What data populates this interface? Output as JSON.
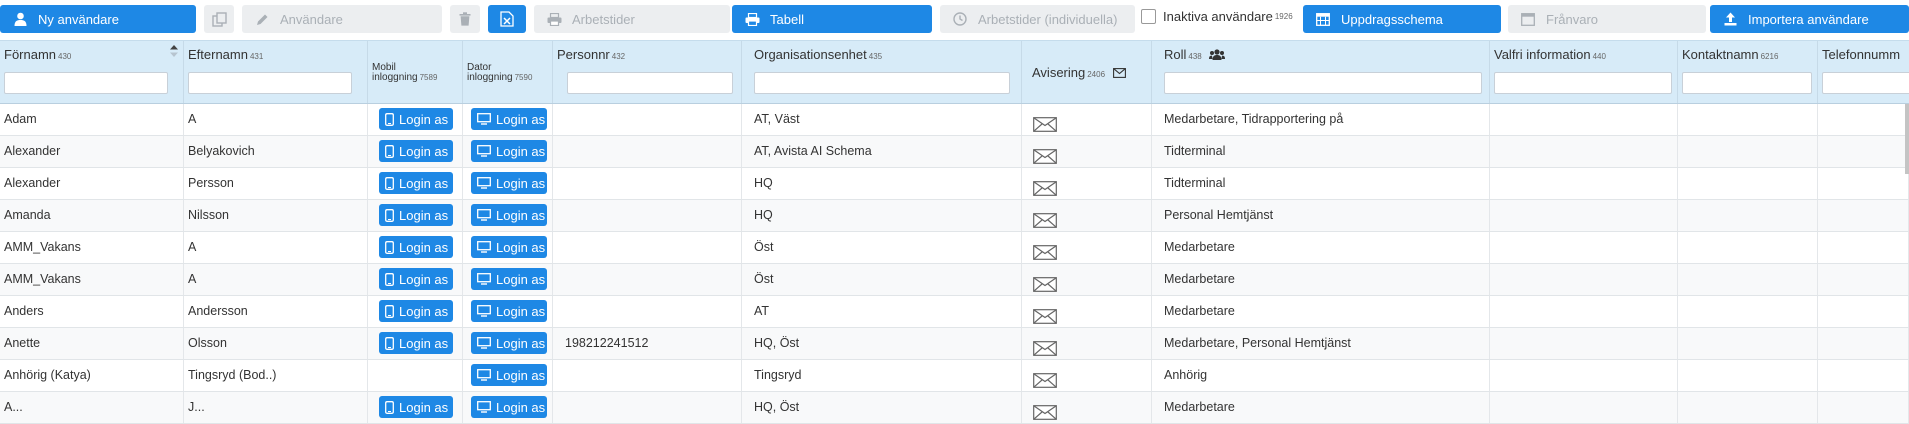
{
  "toolbar": {
    "new_user": "Ny användare",
    "users": "Användare",
    "worktimes": "Arbetstider",
    "table": "Tabell",
    "worktimes_individual": "Arbetstider (individuella)",
    "inactive_label": "Inaktiva användare",
    "inactive_count": "1926",
    "assignment_schedule": "Uppdragsschema",
    "absence": "Frånvaro",
    "import_users": "Importera användare"
  },
  "columns": {
    "firstname": {
      "label": "Förnamn",
      "num": "430"
    },
    "lastname": {
      "label": "Efternamn",
      "num": "431"
    },
    "mobile": {
      "label": "Mobil inloggning",
      "num": "7589"
    },
    "desktop": {
      "label": "Dator inloggning",
      "num": "7590"
    },
    "personnr": {
      "label": "Personnr",
      "num": "432"
    },
    "org": {
      "label": "Organisationsenhet",
      "num": "435"
    },
    "notify": {
      "label": "Avisering",
      "num": "2406"
    },
    "role": {
      "label": "Roll",
      "num": "438"
    },
    "optional": {
      "label": "Valfri information",
      "num": "440"
    },
    "contact": {
      "label": "Kontaktnamn",
      "num": "6216"
    },
    "phone": {
      "label": "Telefonnumm"
    }
  },
  "login_label": "Login as",
  "rows": [
    {
      "first": "Adam",
      "last": "A",
      "mobile": true,
      "desktop": true,
      "pnr": "",
      "org": "AT, Väst",
      "role": "Medarbetare, Tidrapportering på"
    },
    {
      "first": "Alexander",
      "last": "Belyakovich",
      "mobile": true,
      "desktop": true,
      "pnr": "",
      "org": "AT, Avista AI Schema",
      "role": "Tidterminal"
    },
    {
      "first": "Alexander",
      "last": "Persson",
      "mobile": true,
      "desktop": true,
      "pnr": "",
      "org": "HQ",
      "role": "Tidterminal"
    },
    {
      "first": "Amanda",
      "last": "Nilsson",
      "mobile": true,
      "desktop": true,
      "pnr": "",
      "org": "HQ",
      "role": "Personal Hemtjänst"
    },
    {
      "first": "AMM_Vakans",
      "last": "A",
      "mobile": true,
      "desktop": true,
      "pnr": "",
      "org": "Öst",
      "role": "Medarbetare"
    },
    {
      "first": "AMM_Vakans",
      "last": "A",
      "mobile": true,
      "desktop": true,
      "pnr": "",
      "org": "Öst",
      "role": "Medarbetare"
    },
    {
      "first": "Anders",
      "last": "Andersson",
      "mobile": true,
      "desktop": true,
      "pnr": "",
      "org": "AT",
      "role": "Medarbetare"
    },
    {
      "first": "Anette",
      "last": "Olsson",
      "mobile": true,
      "desktop": true,
      "pnr": "198212241512",
      "org": "HQ, Öst",
      "role": "Medarbetare, Personal Hemtjänst"
    },
    {
      "first": "Anhörig (Katya)",
      "last": "Tingsryd (Bod..)",
      "mobile": false,
      "desktop": true,
      "pnr": "",
      "org": "Tingsryd",
      "role": "Anhörig"
    },
    {
      "first": "A...",
      "last": "J...",
      "mobile": true,
      "desktop": true,
      "pnr": "",
      "org": "HQ, Öst",
      "role": "Medarbetare"
    }
  ],
  "colors": {
    "primary": "#1e88e5",
    "header_bg": "#d7ebf8",
    "disabled_bg": "#eceef0"
  }
}
